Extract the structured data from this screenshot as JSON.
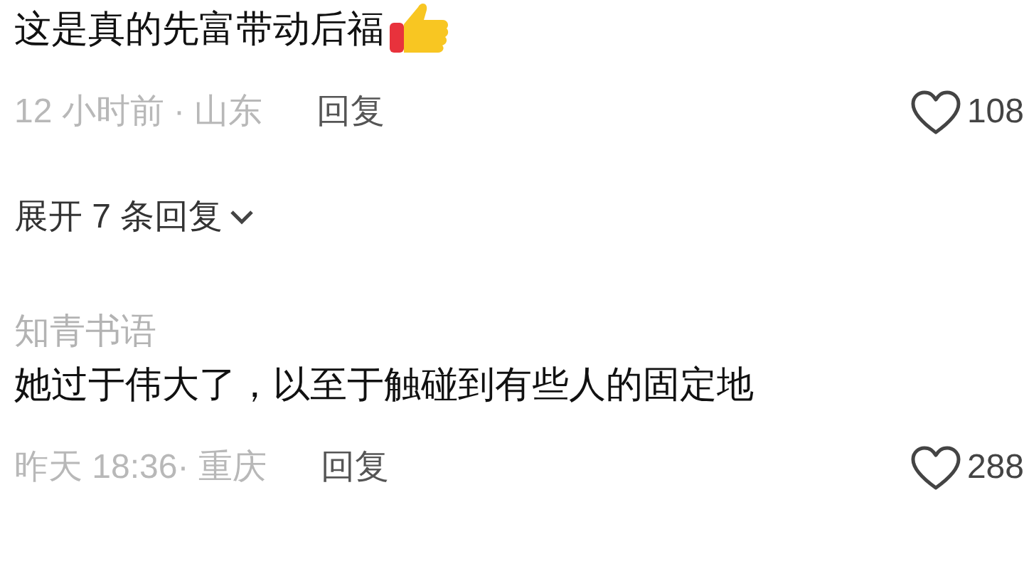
{
  "comments": [
    {
      "text": "这是真的先富带动后福",
      "time_location": "12 小时前 · 山东",
      "reply": "回复",
      "likes": "108",
      "replies_toggle": "展开 7 条回复"
    },
    {
      "author": "知青书语",
      "text": "她过于伟大了，以至于触碰到有些人的固定地",
      "time_location": "昨天 18:36· 重庆",
      "reply": "回复",
      "likes": "288"
    }
  ]
}
